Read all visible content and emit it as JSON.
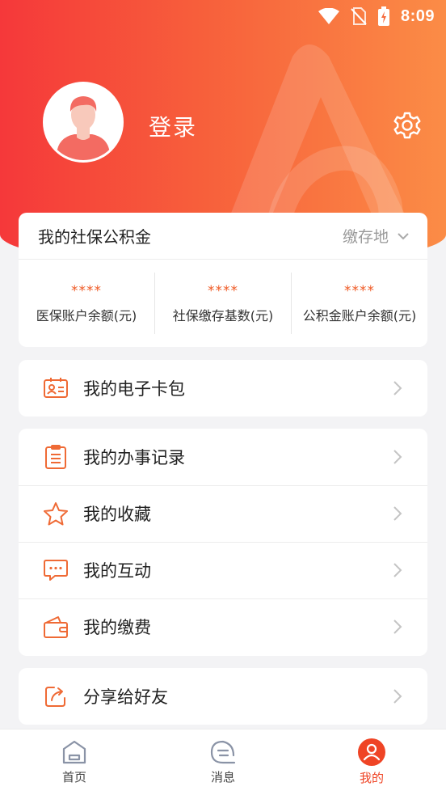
{
  "status_bar": {
    "time": "8:09"
  },
  "profile": {
    "login_label": "登录"
  },
  "fund_card": {
    "title": "我的社保公积金",
    "location_label": "缴存地",
    "stats": [
      {
        "value": "****",
        "label": "医保账户余额(元)"
      },
      {
        "value": "****",
        "label": "社保缴存基数(元)"
      },
      {
        "value": "****",
        "label": "公积金账户余额(元)"
      }
    ]
  },
  "menu": {
    "wallet": "我的电子卡包",
    "records": "我的办事记录",
    "favorites": "我的收藏",
    "interactions": "我的互动",
    "payments": "我的缴费",
    "share": "分享给好友"
  },
  "tabbar": {
    "home": "首页",
    "messages": "消息",
    "mine": "我的"
  },
  "colors": {
    "accent": "#ef4425",
    "icon": "#ef6a35",
    "hero_start": "#f5383a",
    "hero_end": "#fb8c46"
  }
}
